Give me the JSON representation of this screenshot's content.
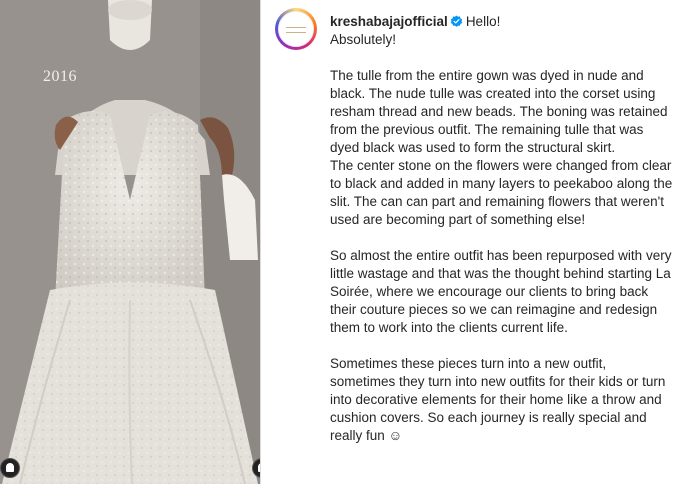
{
  "post": {
    "photo_year": "2016",
    "username": "kreshabajajofficial",
    "greeting": "Hello!",
    "first_line": "Absolutely!",
    "paragraphs": [
      "The tulle from the entire gown was dyed in nude and black. The nude tulle was created into the corset using resham thread and new beads. The boning was retained from the previous outfit. The remaining tulle that was dyed black was used to form the structural skirt.",
      "The center stone on the flowers were changed from clear to black and added in many layers to peekaboo along the slit. The can can part and remaining flowers that weren't used are becoming part of something else!",
      "So almost the entire outfit has been repurposed with very little wastage and that was the thought behind starting La Soirée, where we encourage our clients to bring back their couture pieces so we can reimagine and redesign them to work into the clients current life.",
      "Sometimes these pieces turn into a new outfit, sometimes they turn into new outfits for their kids or turn into decorative elements for their home like a throw and cushion covers. So each journey is really special and really fun ☺"
    ]
  },
  "colors": {
    "verified": "#0095f6",
    "text": "#262626"
  }
}
